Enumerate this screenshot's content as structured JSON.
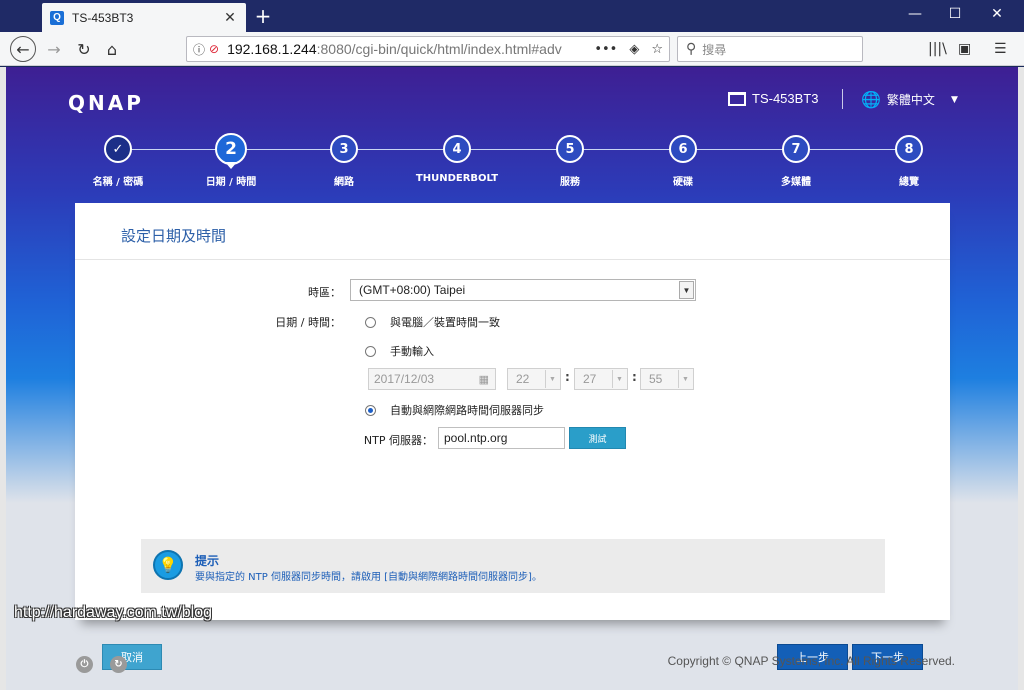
{
  "browser": {
    "tab_title": "TS-453BT3",
    "tab_favicon": "Q",
    "url_host": "192.168.1.244",
    "url_rest": ":8080/cgi-bin/quick/html/index.html#adv",
    "search_placeholder": "搜尋"
  },
  "header": {
    "logo": "QNAP",
    "device_name": "TS-453BT3",
    "language": "繁體中文"
  },
  "steps": [
    {
      "num": "✓",
      "label": "名稱 / 密碼",
      "state": "done"
    },
    {
      "num": "2",
      "label": "日期 / 時間",
      "state": "current"
    },
    {
      "num": "3",
      "label": "網路",
      "state": "todo"
    },
    {
      "num": "4",
      "label": "THUNDERBOLT",
      "state": "todo"
    },
    {
      "num": "5",
      "label": "服務",
      "state": "todo"
    },
    {
      "num": "6",
      "label": "硬碟",
      "state": "todo"
    },
    {
      "num": "7",
      "label": "多媒體",
      "state": "todo"
    },
    {
      "num": "8",
      "label": "總覽",
      "state": "todo"
    }
  ],
  "card": {
    "title": "設定日期及時間",
    "timezone_label": "時區：",
    "timezone_value": "(GMT+08:00) Taipei",
    "datetime_label": "日期 / 時間：",
    "option_sync_pc": "與電腦／裝置時間一致",
    "option_manual": "手動輸入",
    "manual_date": "2017/12/03",
    "manual_hour": "22",
    "manual_minute": "27",
    "manual_second": "55",
    "option_ntp": "自動與網際網路時間伺服器同步",
    "ntp_label": "NTP 伺服器：",
    "ntp_value": "pool.ntp.org",
    "test_button": "測試",
    "selected_option": "ntp"
  },
  "tip": {
    "title": "提示",
    "text": "要與指定的 NTP 伺服器同步時間，請啟用 [自動與網際網路時間伺服器同步]。"
  },
  "buttons": {
    "cancel": "取消",
    "prev": "上一步",
    "next": "下一步"
  },
  "footer": {
    "copyright": "Copyright © QNAP Systems, Inc. All Rights Reserved.",
    "watermark": "http://hardaway.com.tw/blog"
  },
  "colors": {
    "accent": "#135fb7",
    "title_blue": "#2c5fa8",
    "test_button": "#2a9ec9"
  }
}
